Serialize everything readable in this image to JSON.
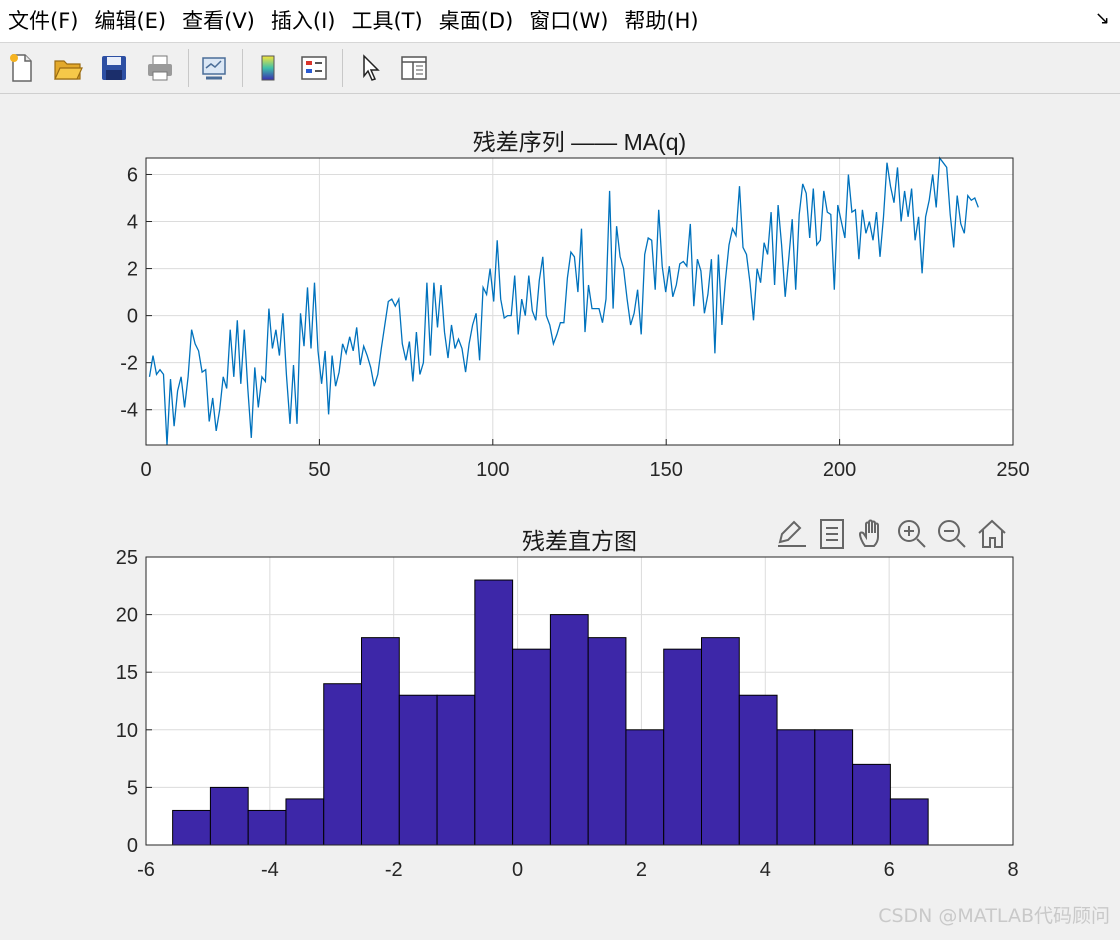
{
  "menubar": {
    "items": [
      "文件(F)",
      "编辑(E)",
      "查看(V)",
      "插入(I)",
      "工具(T)",
      "桌面(D)",
      "窗口(W)",
      "帮助(H)"
    ],
    "corner_glyph": "↘"
  },
  "toolbar": {
    "buttons": [
      "new-file-icon",
      "open-folder-icon",
      "save-icon",
      "print-icon",
      "link-plot-icon",
      "colorbar-icon",
      "legend-icon",
      "pointer-icon",
      "property-inspector-icon"
    ]
  },
  "axes_toolbar": {
    "buttons": [
      "brush-icon",
      "data-tips-icon",
      "pan-hand-icon",
      "zoom-in-icon",
      "zoom-out-icon",
      "home-icon"
    ]
  },
  "colors": {
    "line": "#0072bd",
    "bar_fill": "#3d27a8",
    "bar_edge": "#000000",
    "grid": "#dcdcdc",
    "axes_bg": "#ffffff"
  },
  "chart_data": [
    {
      "type": "line",
      "title": "残差序列 —— MA(q)",
      "xlabel": "",
      "ylabel": "",
      "xlim": [
        0,
        250
      ],
      "ylim": [
        -5.5,
        6.7
      ],
      "xticks": [
        0,
        50,
        100,
        150,
        200,
        250
      ],
      "yticks": [
        -4,
        -2,
        0,
        2,
        4,
        6
      ],
      "xtick_labels": [
        "0",
        "50",
        "100",
        "150",
        "200",
        "250"
      ],
      "ytick_labels": [
        "-4",
        "-2",
        "0",
        "2",
        "4",
        "6"
      ],
      "grid": true,
      "series": [
        {
          "values": [
            -2.6,
            -1.7,
            -2.5,
            -2.3,
            -2.5,
            -5.5,
            -2.7,
            -4.7,
            -3.2,
            -2.6,
            -3.9,
            -2.6,
            -0.6,
            -1.2,
            -1.5,
            -2.4,
            -2.3,
            -4.5,
            -3.5,
            -4.9,
            -4.0,
            -2.6,
            -3.1,
            -0.6,
            -2.6,
            -0.2,
            -2.9,
            -0.6,
            -3.1,
            -5.2,
            -2.2,
            -3.9,
            -2.6,
            -2.8,
            0.3,
            -1.4,
            -0.6,
            -1.7,
            0.1,
            -2.5,
            -4.6,
            -2.1,
            -4.6,
            0.1,
            -1.3,
            1.2,
            -1.4,
            1.4,
            -1.5,
            -2.9,
            -1.5,
            -4.2,
            -1.7,
            -3.0,
            -2.4,
            -1.2,
            -1.6,
            -0.9,
            -1.5,
            -0.5,
            -2.1,
            -1.3,
            -1.7,
            -2.2,
            -3.0,
            -2.5,
            -1.4,
            -0.4,
            0.6,
            0.7,
            0.4,
            0.7,
            -1.2,
            -1.9,
            -1.1,
            -2.8,
            -0.7,
            -2.5,
            -2.0,
            1.4,
            -1.7,
            1.4,
            -0.5,
            1.3,
            -0.7,
            -1.8,
            -0.4,
            -1.4,
            -1.0,
            -1.4,
            -2.4,
            -1.2,
            -0.4,
            0.1,
            -1.9,
            1.2,
            0.9,
            2.0,
            0.6,
            3.2,
            0.7,
            -0.1,
            0.0,
            0.0,
            1.7,
            -0.8,
            0.7,
            0.0,
            1.7,
            0.2,
            -0.2,
            1.5,
            2.5,
            0.0,
            -0.4,
            -1.2,
            -0.8,
            -0.3,
            -0.3,
            1.6,
            2.7,
            2.5,
            1.0,
            3.7,
            -0.7,
            1.3,
            0.3,
            0.3,
            0.3,
            -0.3,
            0.7,
            5.3,
            0.3,
            3.8,
            2.5,
            2.0,
            0.7,
            -0.4,
            0.1,
            1.1,
            -0.8,
            2.6,
            3.3,
            3.2,
            1.1,
            4.5,
            2.1,
            1.0,
            2.1,
            0.8,
            1.3,
            2.2,
            2.3,
            2.1,
            3.9,
            0.4,
            2.4,
            1.9,
            0.1,
            0.9,
            2.4,
            -1.6,
            2.6,
            -0.4,
            1.5,
            3.0,
            3.7,
            3.4,
            5.5,
            2.9,
            2.6,
            1.4,
            -0.2,
            2.0,
            1.4,
            3.1,
            2.6,
            4.4,
            1.3,
            4.7,
            3.0,
            0.8,
            2.4,
            4.1,
            1.1,
            4.3,
            5.6,
            5.2,
            3.3,
            5.4,
            3.0,
            3.2,
            5.3,
            4.4,
            4.3,
            1.1,
            4.7,
            4.0,
            3.3,
            6.0,
            4.4,
            4.5,
            2.4,
            4.5,
            3.5,
            4.0,
            3.2,
            4.4,
            2.5,
            4.2,
            6.5,
            5.5,
            4.8,
            6.3,
            4.0,
            5.3,
            4.2,
            5.4,
            3.2,
            4.2,
            1.8,
            4.2,
            4.9,
            6.0,
            4.6,
            6.7,
            6.5,
            6.3,
            4.3,
            2.9,
            5.1,
            3.9,
            3.5,
            5.1,
            4.9,
            5.0,
            4.6
          ]
        }
      ]
    },
    {
      "type": "bar",
      "title": "残差直方图",
      "xlabel": "",
      "ylabel": "",
      "xlim": [
        -6,
        8
      ],
      "ylim": [
        0,
        25
      ],
      "xticks": [
        -6,
        -4,
        -2,
        0,
        2,
        4,
        6,
        8
      ],
      "yticks": [
        0,
        5,
        10,
        15,
        20,
        25
      ],
      "xtick_labels": [
        "-6",
        "-4",
        "-2",
        "0",
        "2",
        "4",
        "6",
        "8"
      ],
      "ytick_labels": [
        "0",
        "5",
        "10",
        "15",
        "20",
        "25"
      ],
      "grid": true,
      "bin_edges": [
        -5.57,
        -4.96,
        -4.35,
        -3.74,
        -3.13,
        -2.52,
        -1.91,
        -1.3,
        -0.69,
        -0.08,
        0.53,
        1.14,
        1.75,
        2.36,
        2.97,
        3.58,
        4.19,
        4.8,
        5.41,
        6.02,
        6.63
      ],
      "values": [
        3,
        5,
        3,
        4,
        14,
        18,
        13,
        13,
        23,
        17,
        20,
        18,
        10,
        17,
        18,
        13,
        10,
        10,
        7,
        4
      ]
    }
  ],
  "watermark": "CSDN @MATLAB代码顾问"
}
